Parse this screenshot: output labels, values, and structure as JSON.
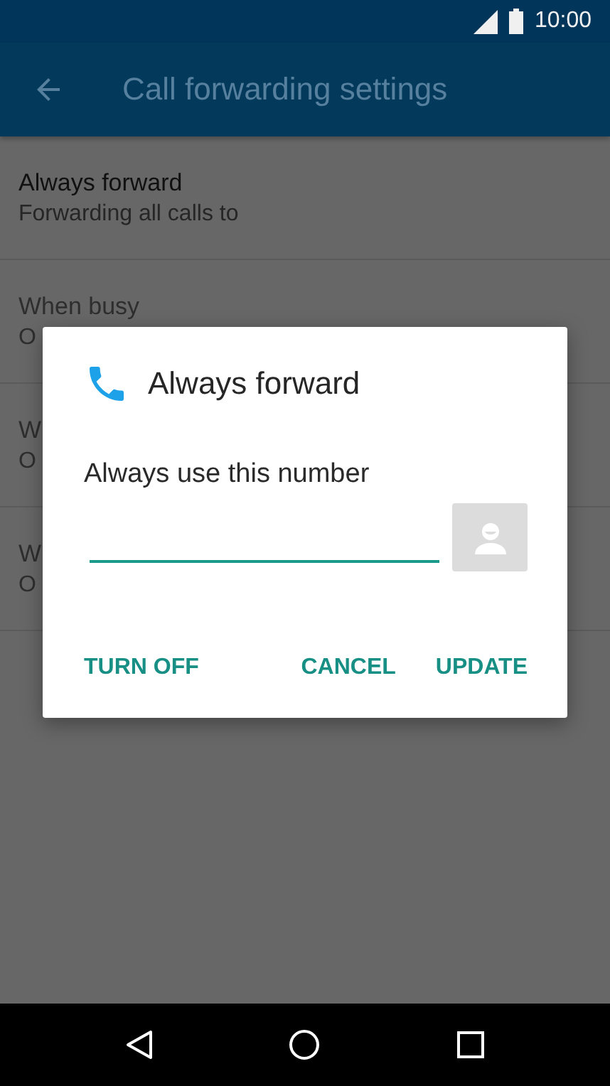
{
  "status_bar": {
    "time": "10:00"
  },
  "app_bar": {
    "title": "Call forwarding settings"
  },
  "settings": [
    {
      "title": "Always forward",
      "summary": "Forwarding all calls to",
      "disabled": false
    },
    {
      "title": "When busy",
      "summary": "O",
      "disabled": true
    },
    {
      "title": "W",
      "summary": "O",
      "disabled": true
    },
    {
      "title": "W",
      "summary": "O",
      "disabled": true
    }
  ],
  "dialog": {
    "title": "Always forward",
    "label": "Always use this number",
    "buttons": [
      "TURN OFF",
      "CANCEL",
      "UPDATE"
    ]
  }
}
